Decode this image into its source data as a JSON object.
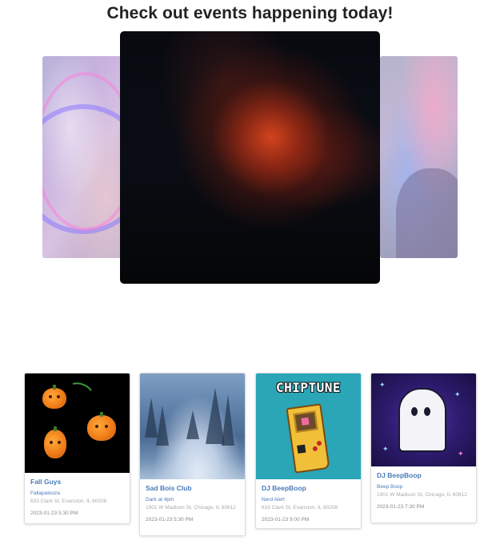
{
  "page": {
    "title": "Check out events happening today!"
  },
  "carousel": {
    "slides": [
      "neon-lights-photo",
      "red-lit-portrait-photo",
      "concert-haze-photo"
    ]
  },
  "events": [
    {
      "name": "Fall Guys",
      "venue": "Fallapalooza",
      "address": "633 Clark St, Evanston, IL 60208",
      "datetime": "2023-01-23 5:30 PM",
      "image": "pumpkins-art"
    },
    {
      "name": "Sad Bois Club",
      "venue": "Dark at 4pm",
      "address": "1901 W Madison St, Chicago, IL 60612",
      "datetime": "2023-01-23 5:30 PM",
      "image": "snowy-forest-art"
    },
    {
      "name": "DJ BeepBoop",
      "venue": "Nerd Alert",
      "address": "633 Clark St, Evanston, IL 60208",
      "datetime": "2023-01-23 9:00 PM",
      "image": "chiptune-gameboy-art",
      "art_text": "CHIPTUNE"
    },
    {
      "name": "DJ BeepBoop",
      "venue": "Beep Boop",
      "address": "1901 W Madison St, Chicago, IL 60612",
      "datetime": "2023-01-23 7:30 PM",
      "image": "pixel-ghost-art"
    }
  ]
}
